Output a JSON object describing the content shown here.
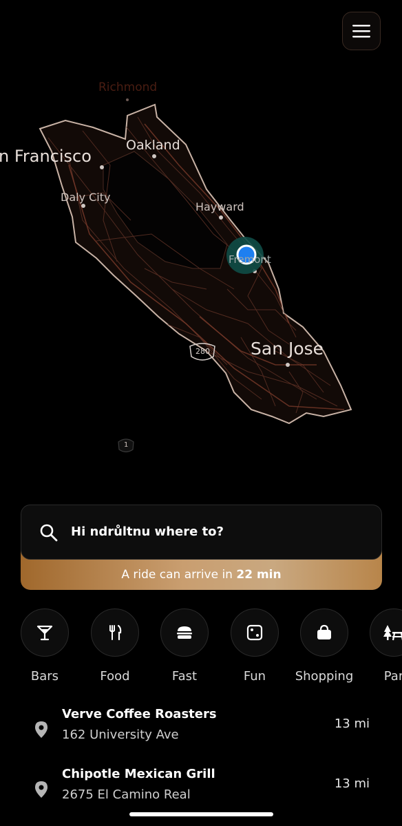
{
  "header": {
    "menu_icon": "hamburger-icon"
  },
  "map": {
    "labels": {
      "san_francisco": "n Francisco",
      "oakland": "Oakland",
      "daly_city": "Daly City",
      "hayward": "Hayward",
      "fremont": "Fremont",
      "san_jose": "San Jose",
      "richmond": "Richmond",
      "route_280": "280",
      "route_1": "1"
    },
    "accent": "#1e7ff0"
  },
  "search": {
    "icon": "search-icon",
    "prompt": "Hi ndrůltnu where to?"
  },
  "eta": {
    "prefix": "A ride can arrive in",
    "time": "22 min"
  },
  "categories": [
    {
      "label": "Bars",
      "icon": "cocktail-icon"
    },
    {
      "label": "Food",
      "icon": "fork-knife-icon"
    },
    {
      "label": "Fast",
      "icon": "burger-icon"
    },
    {
      "label": "Fun",
      "icon": "dice-icon"
    },
    {
      "label": "Shopping",
      "icon": "shopping-bag-icon"
    },
    {
      "label": "Par",
      "icon": "picnic-table-icon"
    }
  ],
  "places": [
    {
      "name": "Verve Coffee Roasters",
      "address": "162 University Ave",
      "distance": "13 mi"
    },
    {
      "name": "Chipotle Mexican Grill",
      "address": "2675 El Camino Real",
      "distance": "13 mi"
    }
  ]
}
